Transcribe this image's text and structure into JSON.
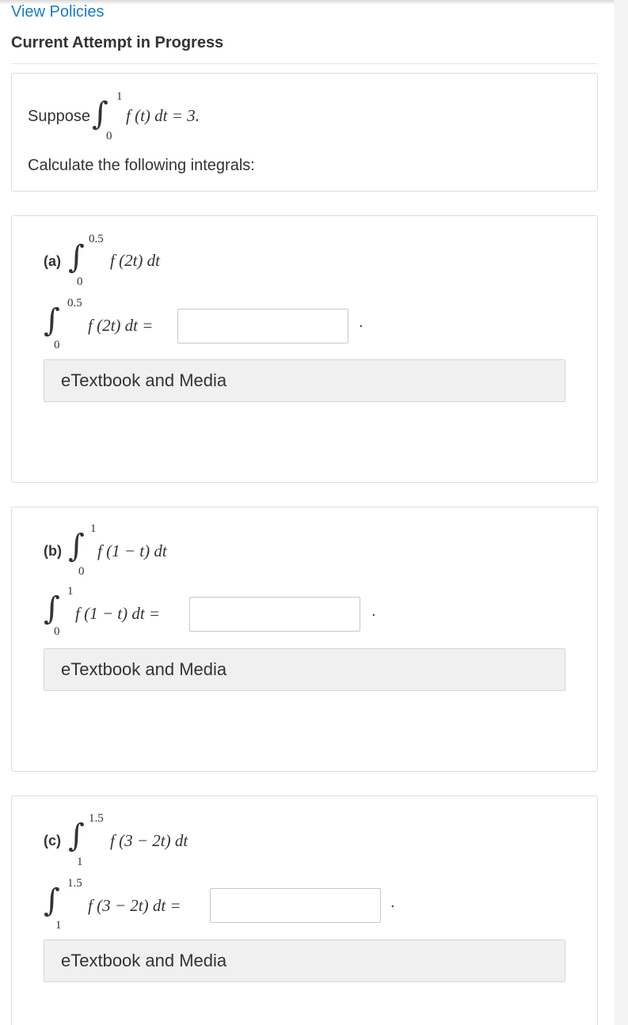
{
  "header": {
    "view_policies": "View Policies",
    "attempt_title": "Current Attempt in Progress"
  },
  "intro": {
    "suppose": "Suppose",
    "given": {
      "upper": "1",
      "lower": "0",
      "integrand": "f (t) dt = 3."
    },
    "instruction": "Calculate the following integrals:"
  },
  "parts": [
    {
      "label": "(a)",
      "question": {
        "upper": "0.5",
        "lower": "0",
        "integrand": "f (2t) dt"
      },
      "answer": {
        "upper": "0.5",
        "lower": "0",
        "integrand": "f (2t) dt =",
        "value": "",
        "period": "."
      },
      "media_label": "eTextbook and Media"
    },
    {
      "label": "(b)",
      "question": {
        "upper": "1",
        "lower": "0",
        "integrand": "f (1 − t) dt"
      },
      "answer": {
        "upper": "1",
        "lower": "0",
        "integrand": "f (1 − t) dt =",
        "value": "",
        "period": "."
      },
      "media_label": "eTextbook and Media"
    },
    {
      "label": "(c)",
      "question": {
        "upper": "1.5",
        "lower": "1",
        "integrand": "f (3 − 2t) dt"
      },
      "answer": {
        "upper": "1.5",
        "lower": "1",
        "integrand": "f (3 − 2t) dt =",
        "value": "",
        "period": "."
      },
      "media_label": "eTextbook and Media"
    }
  ],
  "icons": {
    "integral": "integral-sign-icon"
  },
  "colors": {
    "link": "#1a7cc4",
    "text": "#333333",
    "border": "#dcdcdc",
    "button_bg": "#f0f0f0"
  }
}
